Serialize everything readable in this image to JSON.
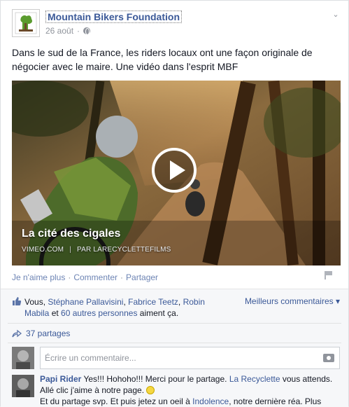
{
  "post": {
    "page_name": "Mountain Bikers Foundation",
    "date": "26 août",
    "text": "Dans le sud de la France, les riders locaux ont une façon originale de négocier avec le maire. Une vidéo dans l'esprit MBF",
    "logo_text": "MBF"
  },
  "video": {
    "title": "La cité des cigales",
    "source": "VIMEO.COM",
    "author": "PAR LARECYCLETTEFILMS"
  },
  "actions": {
    "unlike": "Je n'aime plus",
    "comment": "Commenter",
    "share": "Partager"
  },
  "likes": {
    "prefix": "Vous, ",
    "name1": "Stéphane Pallavisini",
    "sep1": ", ",
    "name2": "Fabrice Teetz",
    "sep2": ", ",
    "name3": "Robin Mabila",
    "sep3": " et ",
    "others": "60 autres personnes",
    "suffix": " aiment ça."
  },
  "top_comments": "Meilleurs commentaires ▾",
  "shares": "37 partages",
  "comment_input": {
    "placeholder": "Écrire un commentaire..."
  },
  "comment": {
    "author": "Papi Rider",
    "part1": " Yes!!! Hohoho!!! Merci pour le partage. ",
    "link1": "La Recyclette",
    "part2": " vous attends. Allé clic j'aime à notre page. ",
    "part3": " Et du partage svp. Et puis jetez un oeil à ",
    "link2": "Indolence",
    "part4": ", notre dernière réa. Plus"
  },
  "colors": {
    "link": "#3b5998",
    "muted": "#90949c",
    "ufi_bg": "#f6f7f9"
  }
}
